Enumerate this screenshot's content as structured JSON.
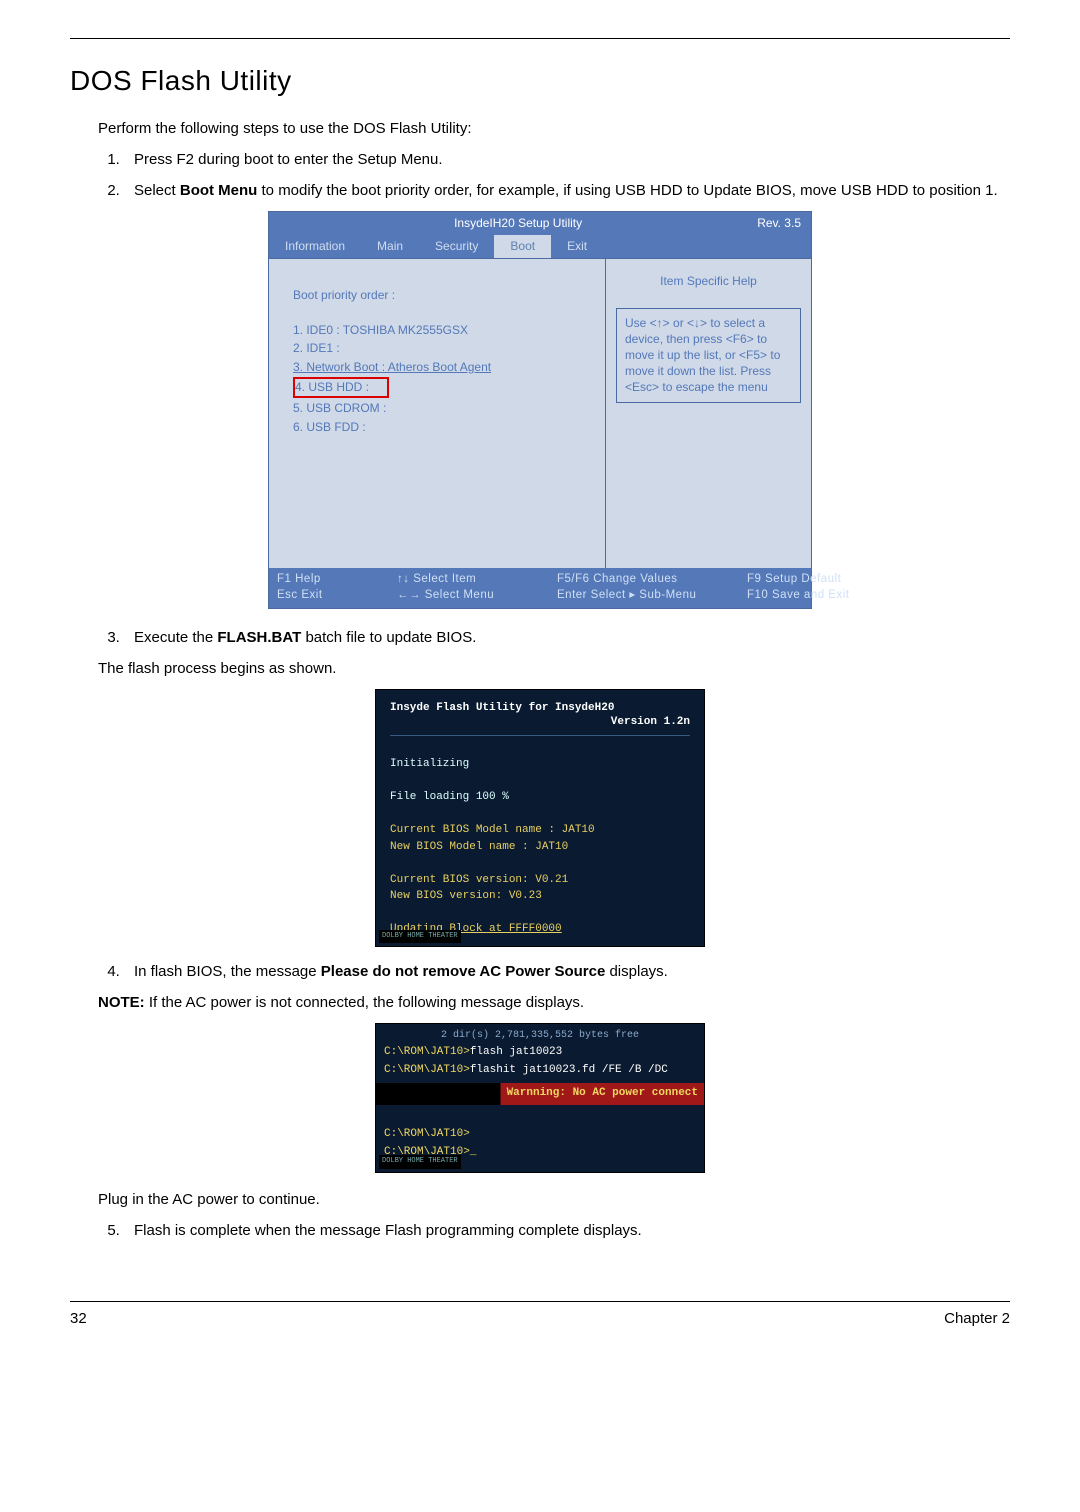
{
  "page": {
    "title": "DOS Flash Utility",
    "intro": "Perform the following steps to use the DOS Flash Utility:",
    "footer_left": "32",
    "footer_right": "Chapter 2"
  },
  "steps": {
    "s1": "Press F2 during boot to enter the Setup Menu.",
    "s2a": "Select ",
    "s2b": "Boot Menu",
    "s2c": " to modify the boot priority order, for example, if using USB HDD to Update BIOS, move USB HDD to position 1.",
    "s3a": "Execute the ",
    "s3b": "FLASH.BAT",
    "s3c": " batch file to update BIOS.",
    "after3": "The flash process begins as shown.",
    "s4a": "In flash BIOS, the message ",
    "s4b": "Please do not remove AC Power Source",
    "s4c": " displays.",
    "note_label": "NOTE:",
    "note_text": " If the AC power is not connected, the following message displays.",
    "plug": "Plug in the AC power to continue.",
    "s5": "Flash is complete when the message Flash programming complete displays."
  },
  "bios": {
    "title_center": "InsydeIH20 Setup Utility",
    "title_right": "Rev.   3.5",
    "tabs": [
      "Information",
      "Main",
      "Security",
      "Boot",
      "Exit"
    ],
    "active_tab_index": 3,
    "left_heading": "Boot priority order :",
    "items": [
      "1. IDE0  :  TOSHIBA MK2555GSX",
      "2. IDE1  :",
      "3. Network Boot :  Atheros Boot Agent",
      "4. USB HDD  :",
      "5. USB CDROM  :",
      "6. USB FDD  :"
    ],
    "highlight_index": 3,
    "right_title": "Item Specific Help",
    "help_text": "Use <↑> or <↓> to select a device, then press <F6> to move it up the list, or <F5> to move it down the list. Press <Esc> to escape the menu",
    "footer": {
      "r1c1": "F1   Help",
      "r1c2": "↑↓   Select  Item",
      "r1c3": "F5/F6   Change  Values",
      "r1c4": "F9     Setup  Default",
      "r2c1": "Esc  Exit",
      "r2c2": "←→   Select  Menu",
      "r2c3": "Enter    Select  ▸  Sub-Menu",
      "r2c4": "F10   Save  and  Exit"
    }
  },
  "term1": {
    "title": "Insyde Flash Utility for InsydeH20",
    "version": "Version 1.2n",
    "l1": "Initializing",
    "l2": "File loading    100 %",
    "l3": "Current BIOS Model name  : JAT10",
    "l4": "New     BIOS Model name  : JAT10",
    "l5": "Current BIOS version: V0.21",
    "l6": "New     BIOS version: V0.23",
    "l7": "Updating Block at FFFF0000",
    "badge": "DOLBY HOME THEATER"
  },
  "term2": {
    "top": "2 dir(s)   2,781,335,552 bytes free",
    "l1a": "C:\\ROM\\JAT10>",
    "l1b": "flash jat10023",
    "l2a": "C:\\ROM\\JAT10>",
    "l2b": "flashit jat10023.fd /FE /B /DC",
    "warn": "Warnning: No AC power connect",
    "l3": "C:\\ROM\\JAT10>",
    "l4": "C:\\ROM\\JAT10>_",
    "badge": "DOLBY HOME THEATER"
  }
}
